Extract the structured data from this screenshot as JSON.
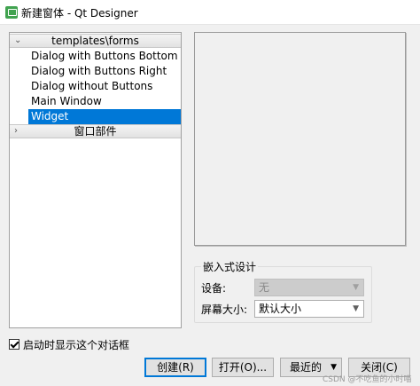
{
  "window": {
    "title": "新建窗体 - Qt Designer"
  },
  "tree": {
    "categories": [
      {
        "label": "templates\\forms",
        "expanded": true,
        "chevron": "⌄"
      },
      {
        "label": "窗口部件",
        "expanded": false,
        "chevron": "›"
      }
    ],
    "items": [
      "Dialog with Buttons Bottom",
      "Dialog with Buttons Right",
      "Dialog without Buttons",
      "Main Window",
      "Widget"
    ],
    "selected": "Widget"
  },
  "embedded": {
    "group_title": "嵌入式设计",
    "device_label": "设备:",
    "device_value": "无",
    "screen_size_label": "屏幕大小:",
    "screen_size_value": "默认大小"
  },
  "startup_checkbox": {
    "label": "启动时显示这个对话框",
    "checked": true
  },
  "buttons": {
    "create": "创建(R)",
    "open": "打开(O)...",
    "recent": "最近的",
    "close": "关闭(C)"
  },
  "watermark": "CSDN @不吃鱼的小时喵",
  "colors": {
    "selection": "#0078d7",
    "app_icon": "#41a350"
  }
}
